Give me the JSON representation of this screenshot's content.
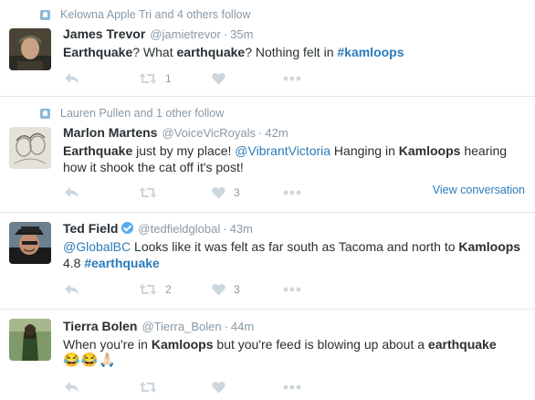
{
  "tweets": [
    {
      "context": "Kelowna Apple Tri and 4 others follow",
      "name": "James Trevor",
      "handle": "@jamietrevor",
      "sep": "·",
      "time": "35m",
      "text": [
        {
          "t": "Earthquake",
          "b": true
        },
        {
          "t": "? What "
        },
        {
          "t": "earthquake",
          "b": true
        },
        {
          "t": "? Nothing felt in "
        },
        {
          "t": "#kamloops",
          "b": true,
          "link": true
        }
      ],
      "retweets": "1",
      "likes": ""
    },
    {
      "context": "Lauren Pullen and 1 other follow",
      "name": "Marlon Martens",
      "handle": "@VoiceVicRoyals",
      "sep": "·",
      "time": "42m",
      "text": [
        {
          "t": "Earthquake",
          "b": true
        },
        {
          "t": " just by my place! "
        },
        {
          "t": "@VibrantVictoria",
          "link": true
        },
        {
          "t": " Hanging in "
        },
        {
          "t": "Kamloops",
          "b": true
        },
        {
          "t": " hearing how it shook the cat off it's post!"
        }
      ],
      "retweets": "",
      "likes": "3",
      "view_conversation": "View conversation"
    },
    {
      "name": "Ted Field",
      "handle": "@tedfieldglobal",
      "sep": "·",
      "time": "43m",
      "verified": true,
      "text": [
        {
          "t": "@GlobalBC",
          "link": true
        },
        {
          "t": " Looks like it was felt as far south as Tacoma and north to "
        },
        {
          "t": "Kamloops",
          "b": true
        },
        {
          "t": " 4.8 "
        },
        {
          "t": "#earthquake",
          "b": true,
          "link": true
        }
      ],
      "retweets": "2",
      "likes": "3"
    },
    {
      "name": "Tierra Bolen",
      "handle": "@Tierra_Bolen",
      "sep": "·",
      "time": "44m",
      "text": [
        {
          "t": "When you're in "
        },
        {
          "t": "Kamloops",
          "b": true
        },
        {
          "t": " but you're feed is blowing up about a "
        },
        {
          "t": "earthquake",
          "b": true
        }
      ],
      "emoji": "😂😂🙏🏻",
      "retweets": "",
      "likes": ""
    }
  ],
  "colors": {
    "link": "#2b7bb9",
    "muted": "#8899a6",
    "icon": "#ccd6dd",
    "divider": "#e1e8ed",
    "verified": "#55acee"
  },
  "icons": {
    "context": "follow-context-icon",
    "reply": "reply-icon",
    "retweet": "retweet-icon",
    "like": "heart-icon",
    "more": "more-icon",
    "verified": "verified-badge-icon"
  }
}
